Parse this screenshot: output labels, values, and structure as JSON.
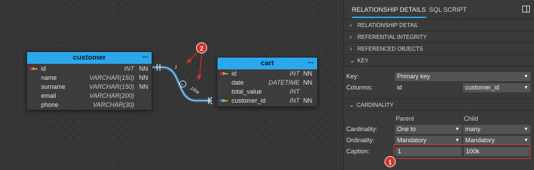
{
  "tables": {
    "customer": {
      "name": "customer",
      "menu": "...",
      "columns": [
        {
          "name": "id",
          "type": "INT",
          "nn": "NN",
          "pk": true
        },
        {
          "name": "name",
          "type": "VARCHAR(150)",
          "nn": "NN",
          "pk": false
        },
        {
          "name": "surname",
          "type": "VARCHAR(150)",
          "nn": "NN",
          "pk": false
        },
        {
          "name": "email",
          "type": "VARCHAR(200)",
          "nn": "",
          "pk": false
        },
        {
          "name": "phone",
          "type": "VARCHAR(30)",
          "nn": "",
          "pk": false
        }
      ]
    },
    "cart": {
      "name": "cart",
      "menu": "...",
      "columns": [
        {
          "name": "id",
          "type": "INT",
          "nn": "NN",
          "key": "pk"
        },
        {
          "name": "date",
          "type": "DATETIME",
          "nn": "NN",
          "key": ""
        },
        {
          "name": "total_value",
          "type": "INT",
          "nn": "",
          "key": ""
        },
        {
          "name": "customer_id",
          "type": "INT",
          "nn": "NN",
          "key": "fk"
        }
      ]
    }
  },
  "relationship": {
    "caption_parent": "1",
    "caption_child": "100k"
  },
  "annotations": {
    "bubble1": "1",
    "bubble2": "2",
    "accent_color": "#d6312a"
  },
  "panel": {
    "tabs": [
      "RELATIONSHIP DETAILS",
      "SQL SCRIPT"
    ],
    "sections_collapsed": [
      "RELATIONSHIP DETAIL",
      "REFERENTIAL INTEGRITY",
      "REFERENCED OBJECTS"
    ],
    "key_section": {
      "title": "KEY",
      "key_label": "Key:",
      "key_value": "Primary key",
      "columns_label": "Columns:",
      "parent_column": "id",
      "child_column": "customer_id"
    },
    "cardinality_section": {
      "title": "CARDINALITY",
      "parent_header": "Parent",
      "child_header": "Child",
      "cardinality_label": "Cardinality:",
      "cardinality_parent": "One to",
      "cardinality_child": "many",
      "ordinality_label": "Ordinality:",
      "ordinality_parent": "Mandatory",
      "ordinality_child": "Mandatory",
      "caption_label": "Caption:",
      "caption_parent": "1",
      "caption_child": "100k"
    }
  },
  "colors": {
    "header_blue": "#2ba7ec",
    "relation_line": "#7cc4f5",
    "highlight_red": "#d23b32"
  }
}
